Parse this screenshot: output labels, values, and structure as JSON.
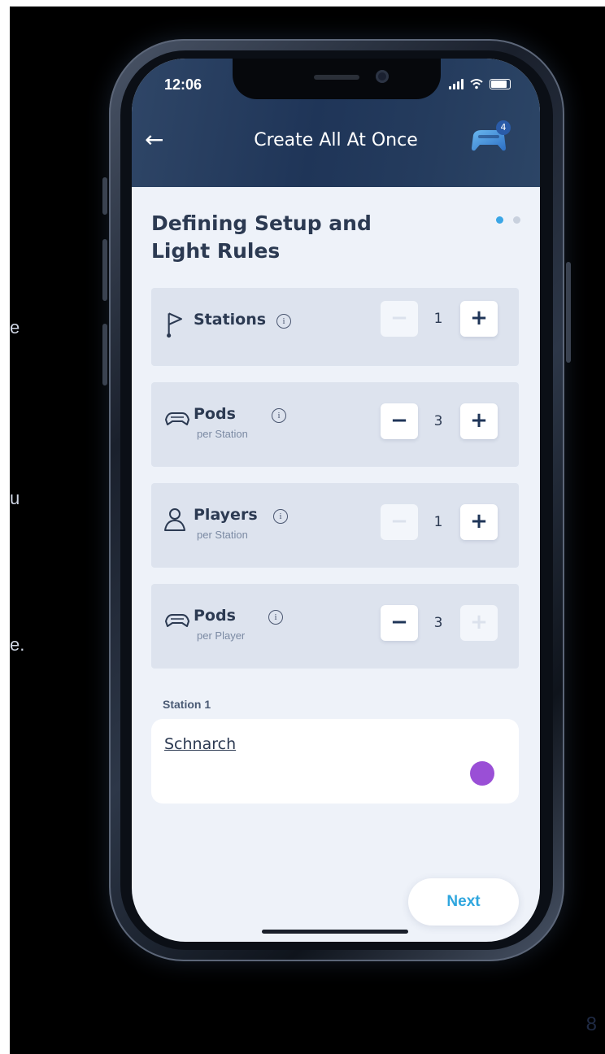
{
  "slide": {
    "side_text_fragments": [
      "e",
      "u",
      "e."
    ],
    "page_number": "8"
  },
  "status_bar": {
    "time": "12:06"
  },
  "header": {
    "back_icon": "arrow-left-icon",
    "title": "Create All At Once",
    "controller_icon": "game-controller-icon",
    "controller_badge": "4"
  },
  "page": {
    "title": "Defining Setup and Light Rules",
    "pagination": {
      "total": 2,
      "active": 0
    }
  },
  "steppers": [
    {
      "label": "Stations",
      "sublabel": "",
      "icon": "flag-icon",
      "value": "1",
      "minus_enabled": false,
      "plus_enabled": true
    },
    {
      "label": "Pods",
      "sublabel": "per Station",
      "icon": "pod-icon",
      "value": "3",
      "minus_enabled": true,
      "plus_enabled": true
    },
    {
      "label": "Players",
      "sublabel": "per Station",
      "icon": "user-icon",
      "value": "1",
      "minus_enabled": false,
      "plus_enabled": true
    },
    {
      "label": "Pods",
      "sublabel": "per Player",
      "icon": "pod-icon",
      "value": "3",
      "minus_enabled": true,
      "plus_enabled": false
    }
  ],
  "stepper_controls": {
    "minus": "−",
    "plus": "+",
    "info": "i"
  },
  "station_section": {
    "label": "Station 1",
    "name": "Schnarch",
    "color": "#9a4fd6"
  },
  "actions": {
    "next_label": "Next"
  },
  "colors": {
    "accent": "#2fa6de",
    "header_bg": "#1f3558",
    "text_dark": "#2c3a52"
  }
}
